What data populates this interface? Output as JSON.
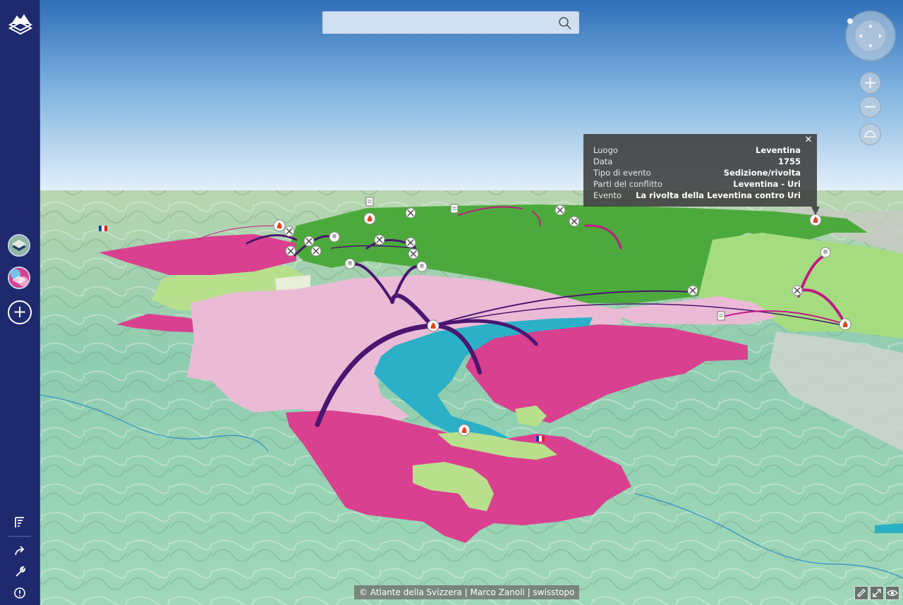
{
  "search": {
    "value": "",
    "placeholder": ""
  },
  "popup": {
    "rows": [
      {
        "key": "Luogo",
        "value": "Leventina"
      },
      {
        "key": "Data",
        "value": "1755"
      },
      {
        "key": "Tipo di evento",
        "value": "Sedizione/rivolta"
      },
      {
        "key": "Parti del conflitto",
        "value": "Leventina - Uri"
      },
      {
        "key": "Evento",
        "value": "La rivolta della Leventina contro Uri"
      }
    ],
    "close_icon": "close-icon"
  },
  "attribution": "© Atlante della Svizzera | Marco Zanoli | swisstopo",
  "sidebar": {
    "logo_icon": "atlas-logo-icon",
    "layers": [
      "relief-layer-thumbnail",
      "thematic-layer-thumbnail"
    ],
    "add_icon": "plus-icon",
    "tools": [
      "legend-icon",
      "share-icon",
      "wrench-icon",
      "help-icon"
    ]
  },
  "nav": {
    "compass_icon": "compass-icon",
    "zoom_in_icon": "zoom-in-icon",
    "zoom_out_icon": "zoom-out-icon",
    "home_view_icon": "home-view-icon"
  },
  "bottom_controls": [
    "ruler-icon",
    "fullscreen-icon",
    "visibility-icon"
  ],
  "colors": {
    "sidebar": "#1f2a6e",
    "region_green": "#4caa3c",
    "region_magenta": "#d9408f",
    "region_light_pink": "#ebbbd6",
    "region_light_green": "#b8e08c",
    "lake": "#2bb0c8",
    "arc_purple": "#4a1670",
    "arc_magenta": "#c01a86"
  },
  "markers": [
    {
      "type": "fire-icon"
    },
    {
      "type": "fire-icon"
    },
    {
      "type": "fire-icon"
    },
    {
      "type": "fire-icon"
    },
    {
      "type": "fire-icon"
    },
    {
      "type": "fire-icon"
    },
    {
      "type": "crossed-swords-icon"
    },
    {
      "type": "crossed-swords-icon"
    },
    {
      "type": "crossed-swords-icon"
    },
    {
      "type": "crossed-swords-icon"
    },
    {
      "type": "crossed-swords-icon"
    },
    {
      "type": "crossed-swords-icon"
    },
    {
      "type": "crossed-swords-icon"
    },
    {
      "type": "crossed-swords-icon"
    },
    {
      "type": "crossed-swords-icon"
    },
    {
      "type": "crossed-swords-icon"
    },
    {
      "type": "crossed-swords-icon"
    },
    {
      "type": "tooth-icon"
    },
    {
      "type": "tooth-icon"
    },
    {
      "type": "tooth-icon"
    },
    {
      "type": "tooth-icon"
    },
    {
      "type": "french-flag-icon"
    },
    {
      "type": "french-flag-icon"
    },
    {
      "type": "document-icon"
    },
    {
      "type": "document-icon"
    },
    {
      "type": "document-icon"
    }
  ]
}
